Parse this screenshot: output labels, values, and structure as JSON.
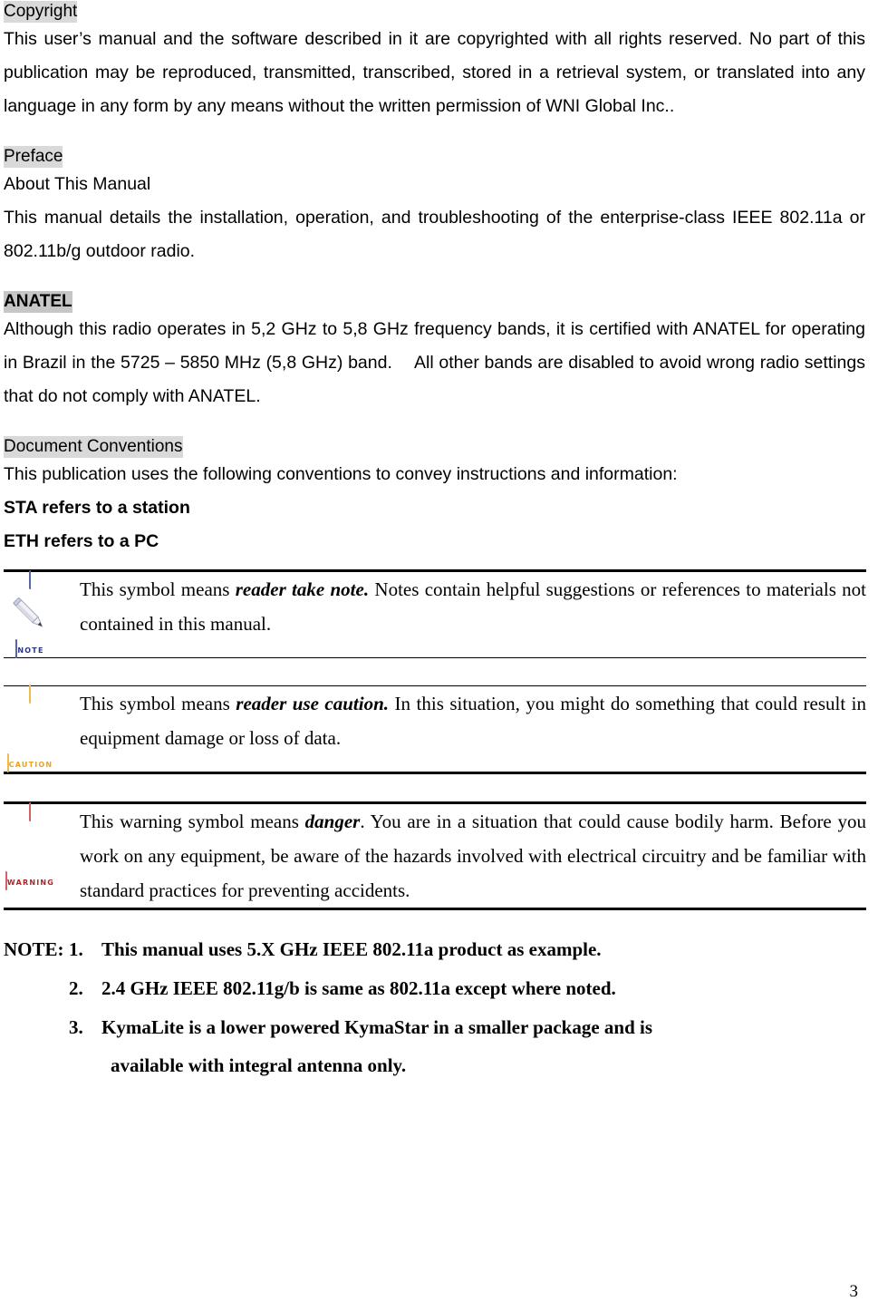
{
  "document": {
    "page_number": "3"
  },
  "sections": {
    "copyright": {
      "heading": "Copyright  ",
      "paragraph": "This user’s manual and the software described in it are copyrighted with all rights reserved. No part of this publication may be reproduced, transmitted, transcribed, stored in a retrieval system, or translated into any language in any form by any means without the written permission of WNI Global Inc.."
    },
    "preface": {
      "heading": "Preface",
      "subheading": "About This Manual",
      "paragraph": "This manual details the installation, operation, and troubleshooting of the enterprise-class IEEE 802.11a or 802.11b/g outdoor radio."
    },
    "anatel": {
      "heading": "ANATEL",
      "paragraph": "Although this radio operates in 5,2 GHz to 5,8 GHz frequency bands, it is certified with ANATEL for operating in Brazil in the 5725 – 5850 MHz (5,8 GHz) band.  All other bands are disabled to avoid wrong radio settings that do not comply with ANATEL."
    },
    "document_conventions": {
      "heading": "Document Conventions",
      "intro": "This publication uses the following conventions to convey instructions and information:",
      "definitions": [
        "STA refers to a station",
        "ETH refers to a PC"
      ]
    }
  },
  "convention_rows": [
    {
      "icon_name": "note-pencil-icon",
      "icon_caption": "NOTE",
      "text_before": "This symbol means ",
      "text_emphasis": "reader take note.",
      "text_after": " Notes contain helpful suggestions or references to materials not contained in this manual."
    },
    {
      "icon_name": "caution-triangle-icon",
      "icon_caption": "CAUTION",
      "text_before": "This symbol means ",
      "text_emphasis": "reader use caution.",
      "text_after": " In this situation, you might do something that could result in equipment damage or loss of data."
    },
    {
      "icon_name": "warning-bolt-icon",
      "icon_caption": "WARNING",
      "text_before": "This warning symbol means ",
      "text_emphasis": "danger",
      "text_after": ". You are in a situation that could cause bodily harm. Before you work on any equipment, be aware of the hazards involved with electrical circuitry and be familiar with standard practices for preventing accidents."
    }
  ],
  "bottom_note": {
    "label": "NOTE:",
    "items": [
      {
        "number": "1.",
        "text": "This manual uses 5.X GHz IEEE 802.11a product as example."
      },
      {
        "number": "2.",
        "text": "2.4 GHz IEEE 802.11g/b is same as 802.11a except where noted."
      },
      {
        "number": "3.",
        "text": "KymaLite is a lower powered KymaStar in a smaller package and is",
        "continuation": "available with integral antenna only."
      }
    ]
  },
  "colors": {
    "highlight_light": "#d9d9d9",
    "highlight_dark": "#c6c6c6",
    "note_blue": "#2b3580",
    "caution_orange": "#eda31c",
    "warning_red": "#b61f24"
  }
}
